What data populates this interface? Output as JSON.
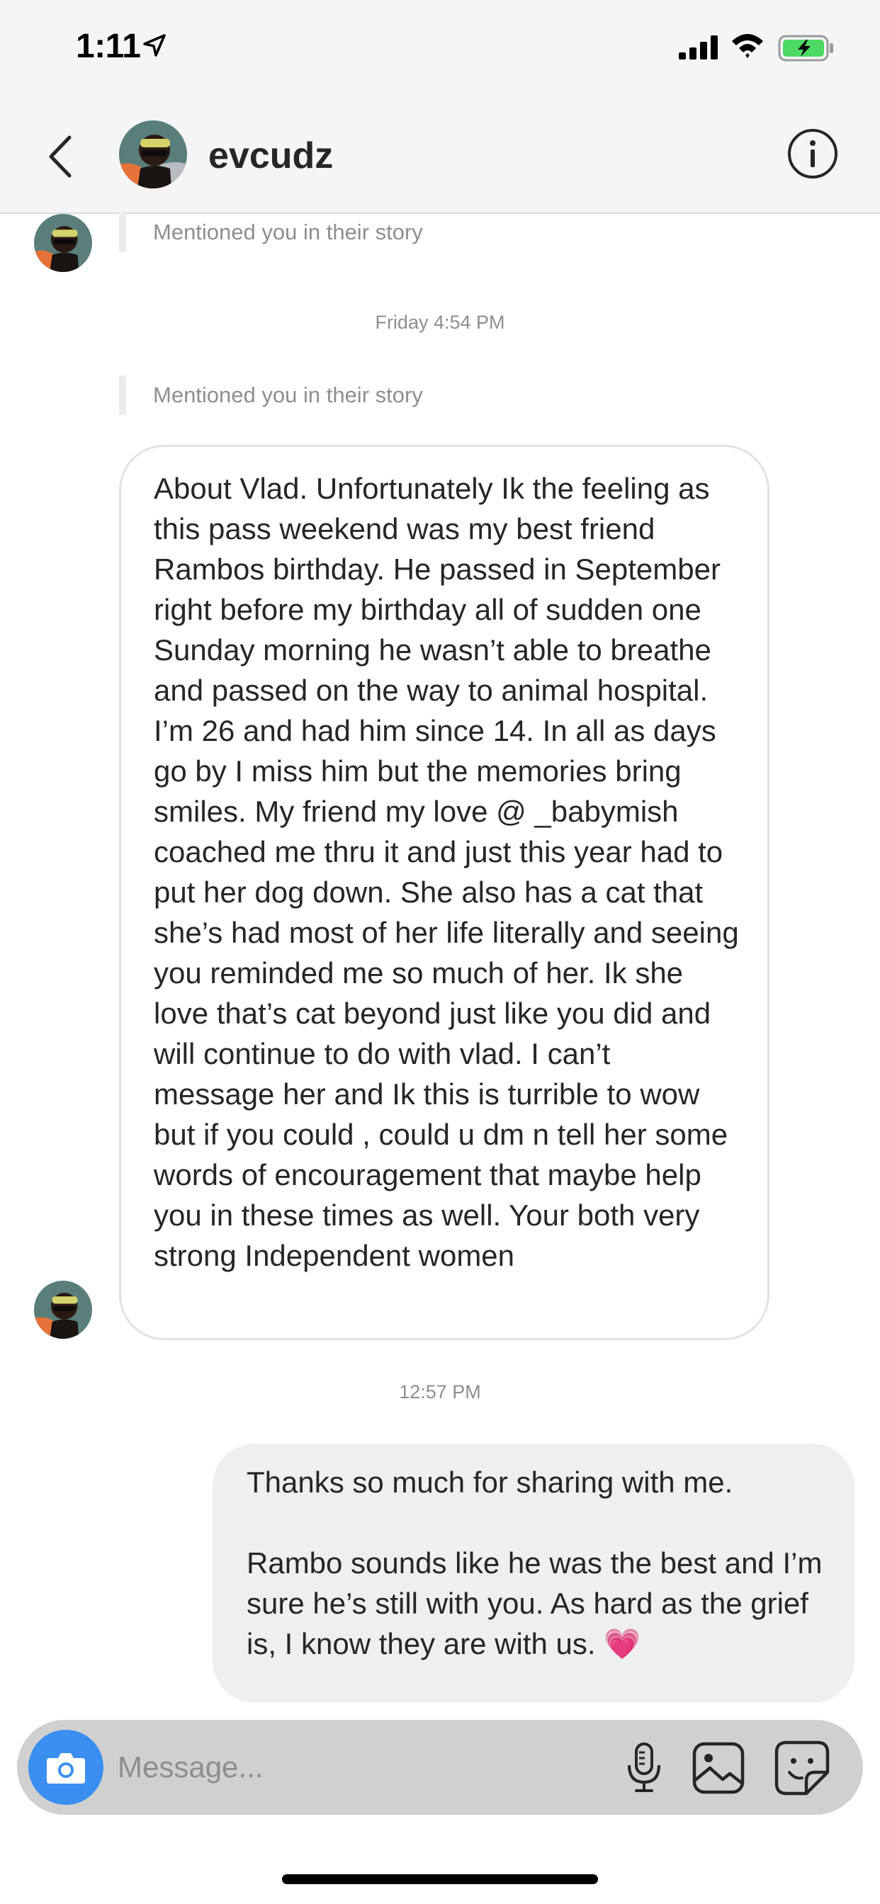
{
  "status_bar": {
    "time": "1:11",
    "icons": [
      "location-arrow-icon",
      "cellular-signal-icon",
      "wifi-icon",
      "battery-charging-icon"
    ],
    "battery_color": "#4cd964"
  },
  "header": {
    "username": "evcudz",
    "icons": [
      "back-chevron-icon",
      "info-icon"
    ]
  },
  "messages": [
    {
      "type": "story_mention",
      "text": "Mentioned you in their story"
    },
    {
      "type": "timestamp",
      "text": "Friday 4:54 PM"
    },
    {
      "type": "story_mention",
      "text": "Mentioned you in their story"
    },
    {
      "type": "incoming",
      "text": "About Vlad. Unfortunately Ik the feeling as this pass weekend was my best friend Rambos birthday. He passed in September right before my birthday all of sudden one Sunday morning he wasn’t able to breathe and passed on the way to animal hospital. I’m 26 and had him since 14. In all as days go by I miss him but the memories bring smiles. My friend my love @ _babymish coached me thru it and just this year had to put her dog down. She also has a cat that she’s had most of her life literally and seeing you reminded me so much of her. Ik she love that’s cat beyond just like you did and will continue to do with  vlad. I can’t message her and Ik this is turrible to wow but if you could , could u dm n tell her some words of encouragement that maybe help you in these times as well. Your both very strong Independent women"
    },
    {
      "type": "timestamp",
      "text": "12:57 PM"
    },
    {
      "type": "outgoing",
      "text": "Thanks so much for sharing with me.\n\nRambo sounds like he was the best and I’m sure he’s still with you. As hard as the grief is, I know they are with us.",
      "emoji": "💗"
    }
  ],
  "composer": {
    "placeholder": "Message...",
    "icons": [
      "camera-icon",
      "microphone-icon",
      "gallery-icon",
      "sticker-icon"
    ],
    "camera_color": "#3b8ff1"
  }
}
